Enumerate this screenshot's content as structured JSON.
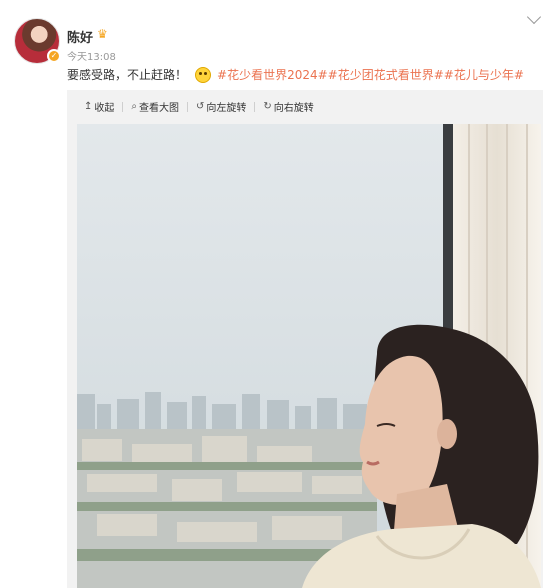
{
  "post": {
    "user_name": "陈好",
    "time": "今天13:08",
    "text": "要感受路，不止赶路！",
    "hashtags": "#花少看世界2024##花少团花式看世界##花儿与少年#"
  },
  "toolbar": {
    "collect": "收起",
    "view_large": "查看大图",
    "rotate_left": "向左旋转",
    "rotate_right": "向右旋转"
  },
  "icons": {
    "collect": "arrow-up-icon",
    "view_large": "magnifier-icon",
    "rotate_left": "rotate-left-icon",
    "rotate_right": "rotate-right-icon"
  },
  "colors": {
    "hashtag": "#eb7350",
    "badge": "#f5a623",
    "panel_bg": "#f2f2f2"
  }
}
